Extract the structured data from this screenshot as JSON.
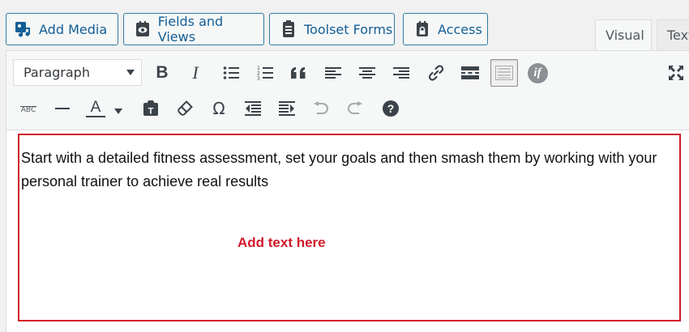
{
  "media_buttons": [
    {
      "label": "Add Media",
      "icon": "add-media-icon"
    },
    {
      "label": "Fields and Views",
      "icon": "fields-views-icon"
    },
    {
      "label": "Toolset Forms",
      "icon": "toolset-forms-icon"
    },
    {
      "label": "Access",
      "icon": "lock-icon"
    }
  ],
  "tabs": {
    "visual": "Visual",
    "text": "Text"
  },
  "toolbar": {
    "format_select": "Paragraph",
    "row1_icons": [
      "bold-icon",
      "italic-icon",
      "bullet-list-icon",
      "numbered-list-icon",
      "blockquote-icon",
      "align-left-icon",
      "align-center-icon",
      "align-right-icon",
      "link-icon",
      "read-more-icon",
      "toolbar-toggle-icon",
      "conditional-if-icon",
      "fullscreen-icon"
    ],
    "row2_icons": [
      "strikethrough-icon",
      "horizontal-line-icon",
      "text-color-icon",
      "paste-text-icon",
      "clear-formatting-icon",
      "special-character-icon",
      "outdent-icon",
      "indent-icon",
      "undo-icon",
      "redo-icon",
      "help-icon"
    ],
    "bold_glyph": "B",
    "italic_glyph": "I",
    "strike_glyph": "ABC",
    "text_color_glyph": "A",
    "omega_glyph": "Ω",
    "if_glyph": "if",
    "help_glyph": "?"
  },
  "content": {
    "paragraph": "Start with a detailed fitness assessment, set your goals and then smash them by working with your personal trainer to achieve real results",
    "hint": "Add text here"
  },
  "colors": {
    "accent": "#2271b1",
    "highlight_border": "#d11a2a"
  }
}
